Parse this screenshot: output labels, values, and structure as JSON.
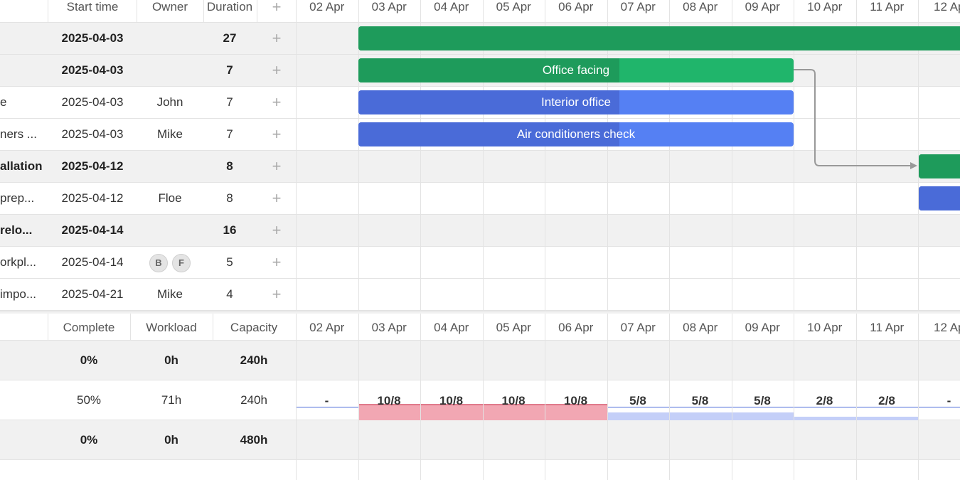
{
  "grid_header": {
    "start_time": "Start time",
    "owner": "Owner",
    "duration": "Duration",
    "add": "+"
  },
  "dates": [
    "02 Apr",
    "03 Apr",
    "04 Apr",
    "05 Apr",
    "06 Apr",
    "07 Apr",
    "08 Apr",
    "09 Apr",
    "10 Apr",
    "11 Apr",
    "12 Ap"
  ],
  "tasks": [
    {
      "name": "",
      "start": "2025-04-03",
      "owner": "",
      "duration": "27",
      "bold": true
    },
    {
      "name": "",
      "start": "2025-04-03",
      "owner": "",
      "duration": "7",
      "bold": true
    },
    {
      "name": "e",
      "start": "2025-04-03",
      "owner": "John",
      "duration": "7",
      "bold": false
    },
    {
      "name": "ners ...",
      "start": "2025-04-03",
      "owner": "Mike",
      "duration": "7",
      "bold": false
    },
    {
      "name": "allation",
      "start": "2025-04-12",
      "owner": "",
      "duration": "8",
      "bold": true
    },
    {
      "name": " prep...",
      "start": "2025-04-12",
      "owner": "Floe",
      "duration": "8",
      "bold": false
    },
    {
      "name": " relo...",
      "start": "2025-04-14",
      "owner": "",
      "duration": "16",
      "bold": true
    },
    {
      "name": "orkpl...",
      "start": "2025-04-14",
      "owner": "",
      "duration": "5",
      "bold": false
    },
    {
      "name": " impo...",
      "start": "2025-04-21",
      "owner": "Mike",
      "duration": "4",
      "bold": false
    }
  ],
  "avatars": [
    "B",
    "F"
  ],
  "bars": {
    "office_facing": "Office facing",
    "interior_office": "Interior office",
    "air_conditioners": "Air conditioners check"
  },
  "resource_header": {
    "complete": "Complete",
    "workload": "Workload",
    "capacity": "Capacity"
  },
  "resources": [
    {
      "complete": "0%",
      "workload": "0h",
      "capacity": "240h",
      "bold": true
    },
    {
      "complete": "50%",
      "workload": "71h",
      "capacity": "240h",
      "bold": false
    },
    {
      "complete": "0%",
      "workload": "0h",
      "capacity": "480h",
      "bold": true
    }
  ],
  "workload_by_day": [
    "-",
    "10/8",
    "10/8",
    "10/8",
    "10/8",
    "5/8",
    "5/8",
    "5/8",
    "2/8",
    "2/8",
    "-"
  ],
  "colors": {
    "task_green": "#20b56b",
    "task_blue": "#5580f3",
    "overload": "#f2a7b3",
    "underload": "#c4cff8"
  }
}
